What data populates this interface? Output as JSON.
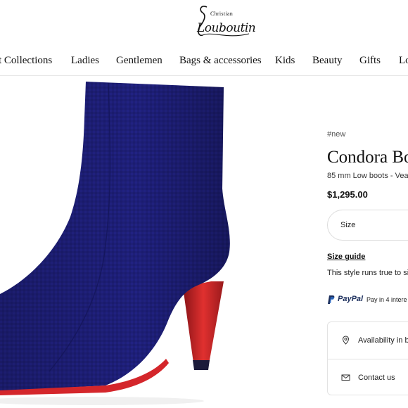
{
  "brand": {
    "top_word": "Christian",
    "script_word": "Louboutin"
  },
  "nav": {
    "items": [
      {
        "label": "t Collections"
      },
      {
        "label": "Ladies"
      },
      {
        "label": "Gentlemen"
      },
      {
        "label": "Bags & accessories"
      },
      {
        "label": "Kids"
      },
      {
        "label": "Beauty"
      },
      {
        "label": "Gifts"
      },
      {
        "label": "Lo"
      }
    ]
  },
  "product": {
    "tag": "#new",
    "title": "Condora Bo",
    "subtitle": "85 mm Low boots - Veau",
    "price": "$1,295.00",
    "image_icon": "suede-ankle-boot-image",
    "colors": {
      "suede": "#1e1f78",
      "sole": "#d4262b"
    }
  },
  "purchase": {
    "size_label": "Size",
    "size_guide": "Size guide",
    "fit_note": "This style runs true to si",
    "paypal_brand": "PayPal",
    "paypal_text": "Pay in 4 intere"
  },
  "services": [
    {
      "label": "Availability in b",
      "icon": "location-pin-icon"
    },
    {
      "label": "Contact us",
      "icon": "mail-icon"
    }
  ]
}
